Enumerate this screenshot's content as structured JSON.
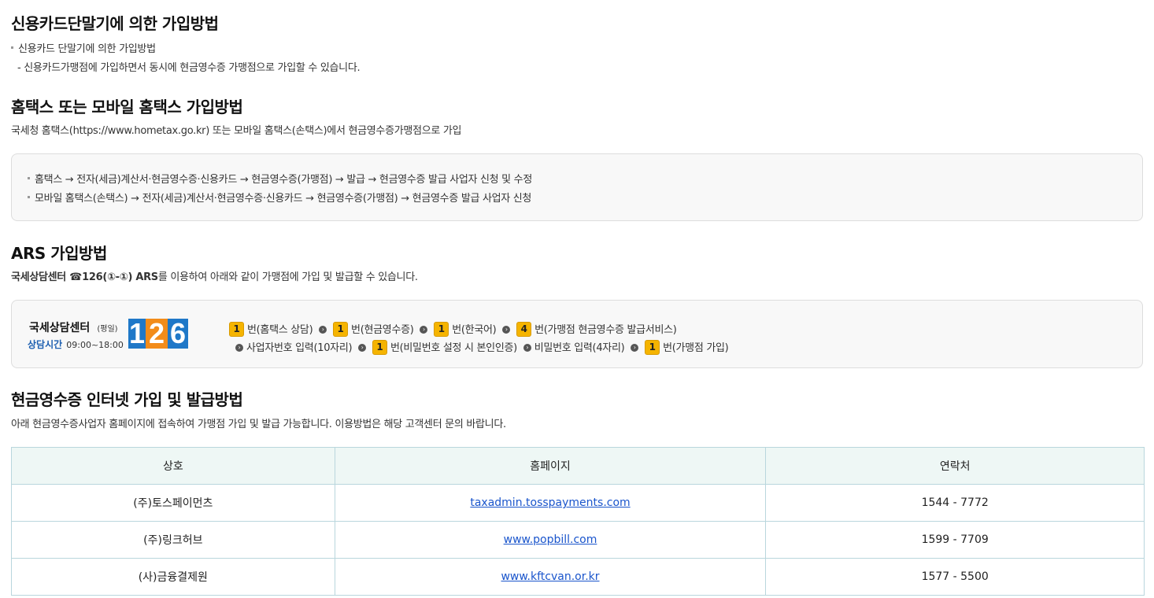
{
  "section1": {
    "title": "신용카드단말기에 의한 가입방법",
    "bullet": "신용카드 단말기에 의한 가입방법",
    "sub": "- 신용카드가맹점에 가입하면서 동시에 현금영수증 가맹점으로 가입할 수 있습니다."
  },
  "section2": {
    "title": "홈택스 또는 모바일 홈택스 가입방법",
    "desc": "국세청 홈택스(https://www.hometax.go.kr) 또는 모바일 홈택스(손택스)에서 현금영수증가맹점으로 가입",
    "paths": [
      "홈택스 → 전자(세금)계산서·현금영수증·신용카드 → 현금영수증(가맹점) → 발급 → 현금영수증 발급 사업자 신청 및 수정",
      "모바일 홈택스(손택스) → 전자(세금)계산서·현금영수증·신용카드 → 현금영수증(가맹점) → 현금영수증 발급 사업자 신청"
    ]
  },
  "section3": {
    "title": "ARS 가입방법",
    "desc_bold": "국세상담센터 ☎126(①-①) ARS",
    "desc_rest": "를 이용하여 아래와 같이 가맹점에 가입 및 발급할 수 있습니다.",
    "center_name": "국세상담센터",
    "weekday": "(평일)",
    "hours_label": "상담시간",
    "hours": "09:00~18:00",
    "logo_digits": [
      "1",
      "2",
      "6"
    ],
    "step_nums": [
      "1",
      "1",
      "1",
      "4",
      "1",
      "1"
    ],
    "step_texts": [
      "번(홈택스 상담)",
      "번(현금영수증)",
      "번(한국어)",
      "번(가맹점 현금영수증 발급서비스)",
      "사업자번호 입력(10자리)",
      "번(비밀번호 설정 시 본인인증)",
      "비밀번호 입력(4자리)",
      "번(가맹점 가입)"
    ]
  },
  "section4": {
    "title": "현금영수증 인터넷 가입 및 발급방법",
    "desc": "아래 현금영수증사업자 홈페이지에 접속하여 가맹점 가입 및 발급 가능합니다. 이용방법은 해당 고객센터 문의 바랍니다.",
    "headers": [
      "상호",
      "홈페이지",
      "연락처"
    ],
    "rows": [
      {
        "name": "(주)토스페이먼츠",
        "site": "taxadmin.tosspayments.com",
        "phone": "1544 - 7772"
      },
      {
        "name": "(주)링크허브",
        "site": "www.popbill.com",
        "phone": "1599 - 7709"
      },
      {
        "name": "(사)금융결제원",
        "site": "www.kftcvan.or.kr",
        "phone": "1577 - 5500"
      }
    ]
  },
  "colors": {
    "step_badge": "#f5b400",
    "link": "#1a55cc",
    "table_header_bg": "#eef7f5",
    "table_border": "#b9d6dd",
    "hours_label": "#1d5fb0",
    "logo_1": "#1f78c8",
    "logo_2": "#f28c1a",
    "logo_6": "#1f78c8"
  }
}
